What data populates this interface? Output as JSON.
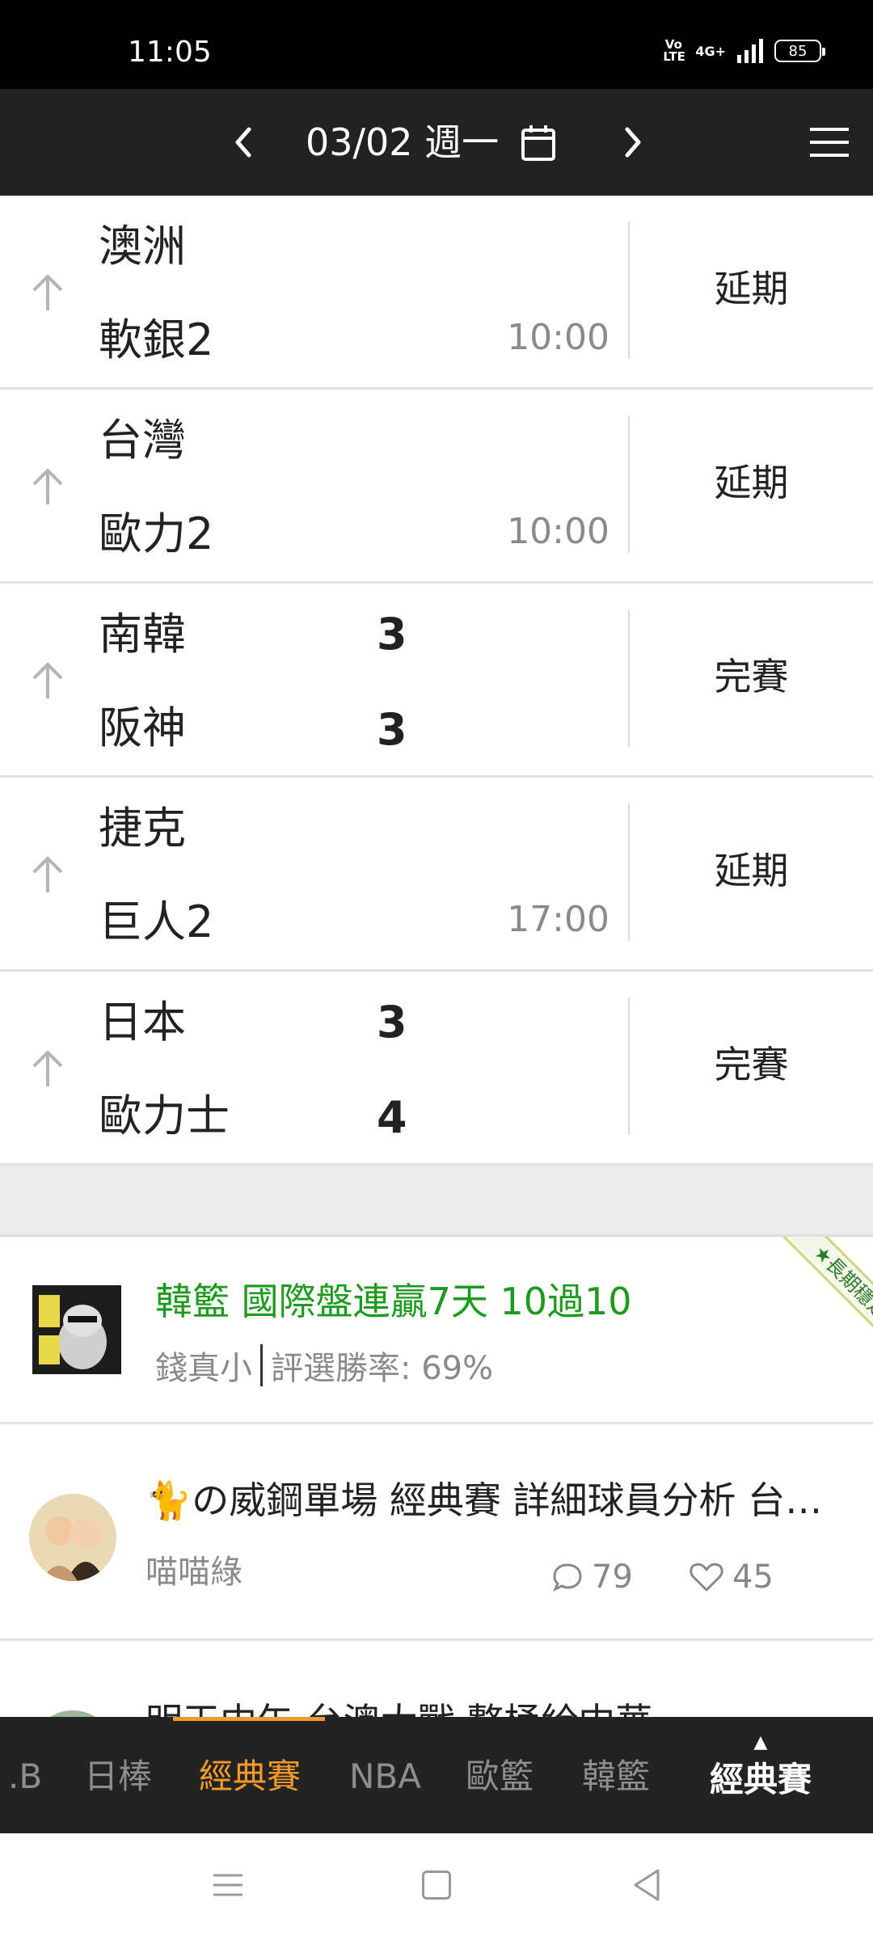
{
  "status_bar": {
    "time": "11:05",
    "volte": "Vo LTE",
    "network": "4G+",
    "battery": "85"
  },
  "header": {
    "date": "03/02 週一",
    "icons": [
      "chevron-left-icon",
      "calendar-icon",
      "chevron-right-icon",
      "menu-icon"
    ]
  },
  "games": [
    {
      "team1": "澳洲",
      "team2": "軟銀2",
      "score1": "",
      "score2": "",
      "time": "10:00",
      "status": "延期"
    },
    {
      "team1": "台灣",
      "team2": "歐力2",
      "score1": "",
      "score2": "",
      "time": "10:00",
      "status": "延期"
    },
    {
      "team1": "南韓",
      "team2": "阪神",
      "score1": "3",
      "score2": "3",
      "time": "",
      "status": "完賽"
    },
    {
      "team1": "捷克",
      "team2": "巨人2",
      "score1": "",
      "score2": "",
      "time": "17:00",
      "status": "延期"
    },
    {
      "team1": "日本",
      "team2": "歐力士",
      "score1": "3",
      "score2": "4",
      "time": "",
      "status": "完賽"
    }
  ],
  "posts": [
    {
      "title": "韓籃 國際盤連贏7天 10過10",
      "author": "錢真小",
      "win_rate": "評選勝率: 69%",
      "badge": "★長期穩定★",
      "title_color": "#1e9a1e"
    },
    {
      "title": "🐈の威鋼單場 經典賽 詳細球員分析 台灣 vs 澳洲",
      "author": "喵喵綠",
      "comments": "79",
      "likes": "45"
    },
    {
      "title": "明天中午 台澳大戰 整桶給中華"
    }
  ],
  "tabbar": {
    "tabs": [
      ".B",
      "日棒",
      "經典賽",
      "NBA",
      "歐籃",
      "韓籃"
    ],
    "active_index": 2,
    "current": "經典賽",
    "accent_color": "#f39a2b"
  },
  "navbar": {
    "icons": [
      "recent-apps-icon",
      "home-icon",
      "back-icon"
    ]
  }
}
